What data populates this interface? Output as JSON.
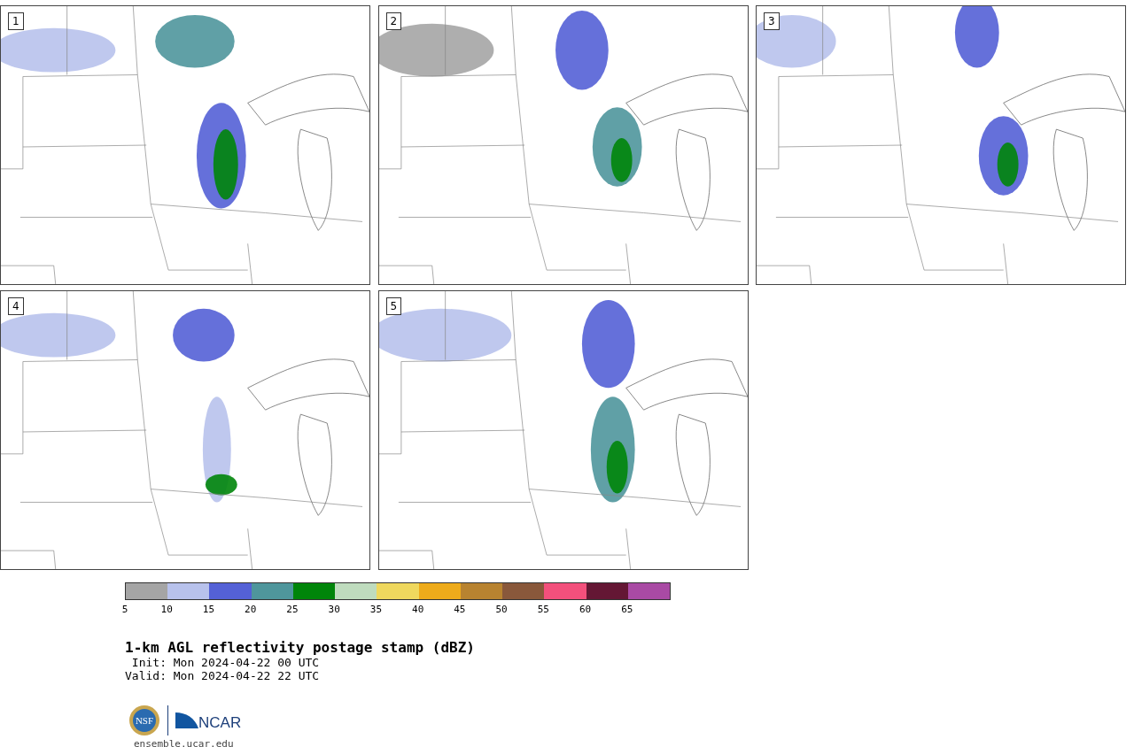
{
  "panels": [
    {
      "label": "1"
    },
    {
      "label": "2"
    },
    {
      "label": "3"
    },
    {
      "label": "4"
    },
    {
      "label": "5"
    }
  ],
  "colorbar": {
    "segments": [
      {
        "color": "#a5a5a5"
      },
      {
        "color": "#b8c2ec"
      },
      {
        "color": "#5461d6"
      },
      {
        "color": "#4f969c"
      },
      {
        "color": "#00850a"
      },
      {
        "color": "#bfdcbe"
      },
      {
        "color": "#efd85e"
      },
      {
        "color": "#eeab1b"
      },
      {
        "color": "#b88330"
      },
      {
        "color": "#89583b"
      },
      {
        "color": "#f3507c"
      },
      {
        "color": "#641734"
      },
      {
        "color": "#a94aa4"
      }
    ],
    "ticks": [
      "5",
      "10",
      "15",
      "20",
      "25",
      "30",
      "35",
      "40",
      "45",
      "50",
      "55",
      "60",
      "65"
    ]
  },
  "title": "1-km AGL reflectivity postage stamp (dBZ)",
  "init": " Init: Mon 2024-04-22 00 UTC",
  "valid": "Valid: Mon 2024-04-22 22 UTC",
  "logos": {
    "nsf": "NSF",
    "ncar": "NCAR"
  },
  "url": "ensemble.ucar.edu"
}
